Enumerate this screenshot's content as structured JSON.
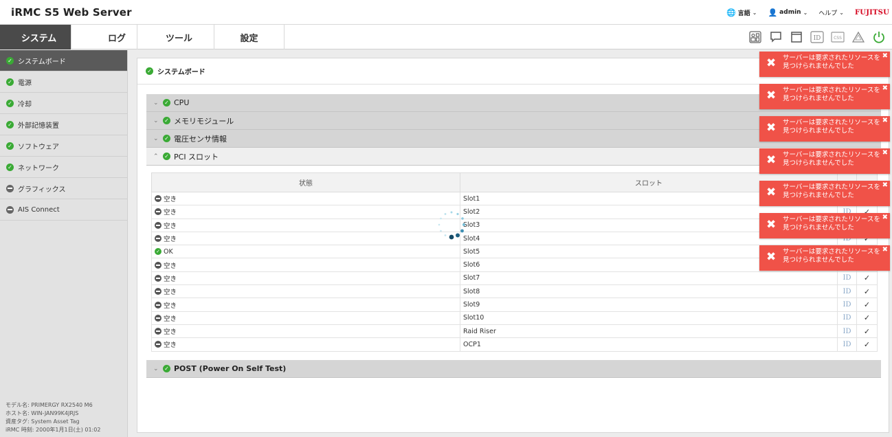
{
  "header": {
    "app_title": "iRMC S5 Web Server",
    "language": "言語",
    "user": "admin",
    "help": "ヘルプ",
    "brand": "FUJITSU"
  },
  "nav": {
    "tabs": [
      "システム",
      "ログ",
      "ツール",
      "設定"
    ],
    "active": 0
  },
  "toolbar_icons": [
    "id-card-icon",
    "chat-icon",
    "window-icon",
    "id-badge-icon",
    "csr-icon",
    "warning-icon",
    "power-icon"
  ],
  "sidebar": {
    "items": [
      {
        "label": "システムボード",
        "status": "ok",
        "active": true
      },
      {
        "label": "電源",
        "status": "ok"
      },
      {
        "label": "冷却",
        "status": "ok"
      },
      {
        "label": "外部記憶装置",
        "status": "ok"
      },
      {
        "label": "ソフトウェア",
        "status": "ok"
      },
      {
        "label": "ネットワーク",
        "status": "ok"
      },
      {
        "label": "グラフィックス",
        "status": "none"
      },
      {
        "label": "AIS Connect",
        "status": "none"
      }
    ],
    "footer": [
      "モデル名: PRIMERGY RX2540 M6",
      "ホスト名: WIN-JAN99K4JRJS",
      "資産タグ: System Asset Tag",
      "iRMC 時刻: 2000年1月1日(土) 01:02"
    ]
  },
  "panel": {
    "title": "システムボード",
    "sections": [
      {
        "label": "CPU",
        "open": false
      },
      {
        "label": "メモリモジュール",
        "open": false
      },
      {
        "label": "電圧センサ情報",
        "open": false
      },
      {
        "label": "PCI スロット",
        "open": true
      },
      {
        "label": "POST (Power On Self Test)",
        "open": false
      }
    ],
    "table": {
      "headers": {
        "status": "状態",
        "slot": "スロット"
      },
      "rows": [
        {
          "status": "空き",
          "ok": false,
          "slot": "Slot1",
          "id": "ID",
          "check": "✓"
        },
        {
          "status": "空き",
          "ok": false,
          "slot": "Slot2",
          "id": "ID",
          "check": "✓"
        },
        {
          "status": "空き",
          "ok": false,
          "slot": "Slot3",
          "id": "ID",
          "check": "✓"
        },
        {
          "status": "空き",
          "ok": false,
          "slot": "Slot4",
          "id": "ID",
          "check": "✓"
        },
        {
          "status": "OK",
          "ok": true,
          "slot": "Slot5",
          "id": "ID",
          "check": "✓"
        },
        {
          "status": "空き",
          "ok": false,
          "slot": "Slot6",
          "id": "ID",
          "check": "✓"
        },
        {
          "status": "空き",
          "ok": false,
          "slot": "Slot7",
          "id": "ID",
          "check": "✓"
        },
        {
          "status": "空き",
          "ok": false,
          "slot": "Slot8",
          "id": "ID",
          "check": "✓"
        },
        {
          "status": "空き",
          "ok": false,
          "slot": "Slot9",
          "id": "ID",
          "check": "✓"
        },
        {
          "status": "空き",
          "ok": false,
          "slot": "Slot10",
          "id": "ID",
          "check": "✓"
        },
        {
          "status": "空き",
          "ok": false,
          "slot": "Raid Riser",
          "id": "ID",
          "check": "✓"
        },
        {
          "status": "空き",
          "ok": false,
          "slot": "OCP1",
          "id": "ID",
          "check": "✓"
        }
      ]
    }
  },
  "toasts": {
    "message_line1": "サーバーは要求されたリソースを",
    "message_line2": "見つけられませんでした",
    "count": 7,
    "color": "#f05248"
  }
}
